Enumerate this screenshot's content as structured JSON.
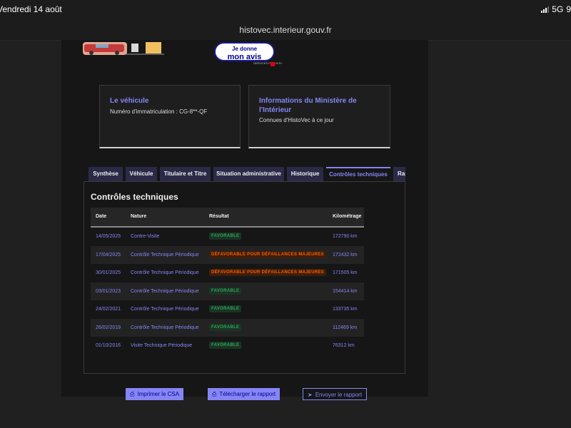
{
  "status_bar": {
    "time": "Vendredi 14 août",
    "network": "5G",
    "battery": "9"
  },
  "browser": {
    "url": "histovec.interieur.gouv.fr"
  },
  "feedback": {
    "line1": "Je donne",
    "line2": "mon avis",
    "sub": "SERVICES PUBLICS+"
  },
  "cards": {
    "vehicle": {
      "title": "Le véhicule",
      "text": "Numéro d'immatriculation : CG-8**-QF"
    },
    "ministry": {
      "title_line1": "Informations du Ministère de",
      "title_line2": "l'Intérieur",
      "text": "Connues d'HistoVec à ce jour"
    }
  },
  "tabs": [
    "Synthèse",
    "Véhicule",
    "Titulaire et Titre",
    "Situation administrative",
    "Historique",
    "Contrôles techniques",
    "Rapport"
  ],
  "active_tab": "Contrôles techniques",
  "section_title": "Contrôles techniques",
  "table": {
    "headers": {
      "date": "Date",
      "nature": "Nature",
      "result": "Résultat",
      "mileage": "Kilométrage"
    },
    "rows": [
      {
        "date": "14/05/2025",
        "nature": "Contre-Visite",
        "result": "FAVORABLE",
        "status": "favorable",
        "mileage": "172790 km"
      },
      {
        "date": "17/04/2025",
        "nature": "Contrôle Technique Périodique",
        "result": "DÉFAVORABLE POUR DÉFAILLANCES MAJEURES",
        "status": "defavorable",
        "mileage": "172432 km"
      },
      {
        "date": "30/01/2025",
        "nature": "Contrôle Technique Périodique",
        "result": "DÉFAVORABLE POUR DÉFAILLANCES MAJEURES",
        "status": "defavorable",
        "mileage": "171505 km"
      },
      {
        "date": "03/01/2023",
        "nature": "Contrôle Technique Périodique",
        "result": "FAVORABLE",
        "status": "favorable",
        "mileage": "154414 km"
      },
      {
        "date": "24/02/2021",
        "nature": "Contrôle Technique Périodique",
        "result": "FAVORABLE",
        "status": "favorable",
        "mileage": "133735 km"
      },
      {
        "date": "26/02/2019",
        "nature": "Contrôle Technique Périodique",
        "result": "FAVORABLE",
        "status": "favorable",
        "mileage": "112469 km"
      },
      {
        "date": "01/10/2016",
        "nature": "Visite Technique Périodique",
        "result": "FAVORABLE",
        "status": "favorable",
        "mileage": "76312 km"
      }
    ]
  },
  "actions": {
    "print": "Imprimer le CSA",
    "download": "Télécharger le rapport",
    "send": "Envoyer le rapport"
  },
  "icons": {
    "print": "printer-icon",
    "download": "download-icon",
    "send": "send-icon"
  },
  "colors": {
    "accent": "#8585f6",
    "favorable": "#27a658",
    "defavorable": "#fc5d00",
    "dark_blue": "#000091"
  }
}
